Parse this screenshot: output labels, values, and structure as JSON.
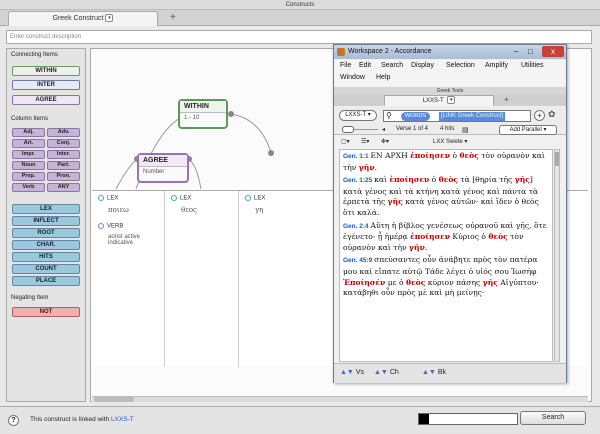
{
  "window_title": "Constructs",
  "tabs": [
    {
      "label": "Greek Construct"
    }
  ],
  "description_placeholder": "Enter construct description",
  "sidebar": {
    "connecting_header": "Connecting Items",
    "connecting": [
      "WITHIN",
      "INTER",
      "AGREE"
    ],
    "column_header": "Column Items",
    "column_items": [
      "Adj.",
      "Adv.",
      "Art.",
      "Conj.",
      "Impr.",
      "Inter.",
      "Noun",
      "Part.",
      "Prep.",
      "Pron.",
      "Verb",
      "ANY"
    ],
    "lex_items": [
      "LEX",
      "INFLECT",
      "ROOT",
      "CHAR.",
      "HITS",
      "COUNT",
      "PLACE"
    ],
    "negating_header": "Negating Item",
    "negating": [
      "NOT"
    ]
  },
  "canvas": {
    "within_node": {
      "title": "WITHIN",
      "value": "1 - 10"
    },
    "agree_node": {
      "title": "AGREE",
      "value": "Number"
    }
  },
  "columns": [
    {
      "items": [
        {
          "type": "LEX",
          "value": "ποιεω"
        },
        {
          "type": "VERB",
          "value": "aorist active indicative"
        }
      ]
    },
    {
      "items": [
        {
          "type": "LEX",
          "value": "θεος"
        }
      ]
    },
    {
      "items": [
        {
          "type": "LEX",
          "value": "γη"
        }
      ]
    }
  ],
  "status": {
    "prefix": "This construct is linked with",
    "link": "LXXS-T",
    "search_label": "Search"
  },
  "accordance": {
    "title": "Workspace 2 - Accordance",
    "menu_row1": [
      "File",
      "Edit",
      "Search",
      "Display",
      "Selection",
      "Amplify",
      "Utilities"
    ],
    "menu_row2": [
      "Window",
      "Help"
    ],
    "pane_title": "Greek Texts",
    "tab_label": "LXXS-T",
    "text_select": "LXXS-T",
    "words_label": "WORDS",
    "search_value": "[LINK Greek Construct]",
    "verse_label": "Verse 1 of 4",
    "hits_label": "4 hits",
    "add_parallel": "Add Parallel",
    "swete_label": "LXX Swete",
    "verses": [
      {
        "ref": "Gen. 1:1",
        "parts": [
          {
            "t": "ΕΝ ΑΡΧΗ "
          },
          {
            "t": "ἐποίησεν",
            "r": true
          },
          {
            "t": " ὁ "
          },
          {
            "t": "θεὸς",
            "r": true
          },
          {
            "t": " τὸν οὐρανὸν καὶ τὴν "
          },
          {
            "t": "γῆν",
            "r": true
          },
          {
            "t": "."
          }
        ]
      },
      {
        "ref": "Gen. 1:25",
        "parts": [
          {
            "t": "καὶ "
          },
          {
            "t": "ἐποίησεν",
            "r": true
          },
          {
            "t": " ὁ "
          },
          {
            "t": "θεὸς",
            "r": true
          },
          {
            "t": " τὰ [θηρία τῆς "
          },
          {
            "t": "γῆς",
            "r": true
          },
          {
            "t": "] κατὰ γένος καὶ τὰ κτήνη κατὰ γένος καὶ πάντα τὰ ἑρπετὰ τῆς "
          },
          {
            "t": "γῆς",
            "r": true
          },
          {
            "t": " κατὰ γένος αὐτῶν· καὶ ἴδεν ὁ θεὸς ὅτι καλά."
          }
        ]
      },
      {
        "ref": "Gen. 2:4",
        "parts": [
          {
            "t": "Αὕτη ἡ βίβλος γενέσεως οὐρανοῦ καὶ γῆς, ὅτε ἐγένετο· ᾗ ἡμέρᾳ "
          },
          {
            "t": "ἐποίησεν",
            "r": true
          },
          {
            "t": " Κύριος ὁ "
          },
          {
            "t": "θεὸς",
            "r": true
          },
          {
            "t": " τὸν οὐρανὸν καὶ τὴν "
          },
          {
            "t": "γῆν",
            "r": true
          },
          {
            "t": "."
          }
        ]
      },
      {
        "ref": "Gen. 45:9",
        "parts": [
          {
            "t": "σπεύσαντες οὖν ἀνάβητε πρὸς τὸν πατέρα μου καὶ εἴπατε αὐτῷ Τάδε λέγει ὁ υἱός σου Ἰωσήφ "
          },
          {
            "t": "Ἐποίησέν",
            "r": true
          },
          {
            "t": " με ὁ "
          },
          {
            "t": "θεὸς",
            "r": true
          },
          {
            "t": " κύριον πάσης "
          },
          {
            "t": "γῆς",
            "r": true
          },
          {
            "t": " Αἰγύπτου· κατάβηθι οὖν πρὸς μὲ καὶ μὴ μείνῃς·"
          }
        ]
      }
    ],
    "footer": [
      "Vs",
      "Ch",
      "Bk"
    ]
  }
}
